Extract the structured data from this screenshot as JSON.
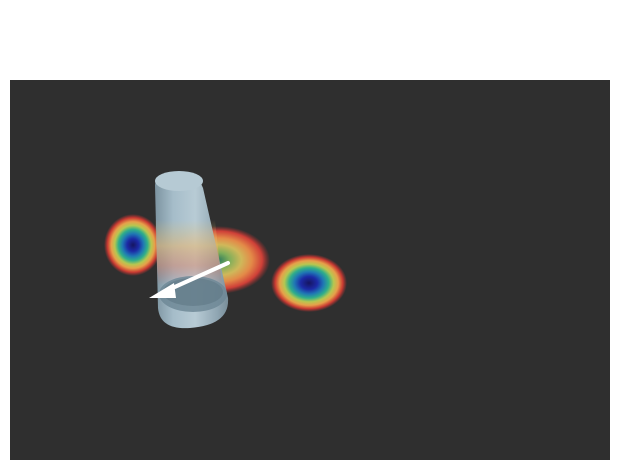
{
  "viewport": {
    "background": "#2f2f2f"
  },
  "scene": {
    "object": {
      "icon": "cylinder-icon",
      "color": "#a9c2cf"
    },
    "heatmap_blobs": [
      {
        "name": "blob-left",
        "core_color": "#1a1a6e"
      },
      {
        "name": "blob-center",
        "core_color": "#2f7a54"
      },
      {
        "name": "blob-right",
        "core_color": "#1a1a6e"
      }
    ],
    "arrow": {
      "icon": "direction-arrow-icon",
      "color": "#ffffff"
    }
  }
}
